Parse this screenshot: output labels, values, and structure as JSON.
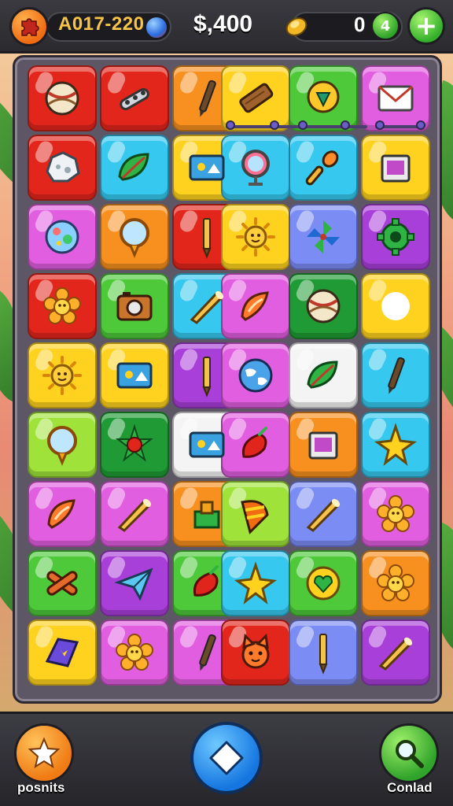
{
  "hud": {
    "level_text": "A017-220",
    "money": "$,400",
    "coins": "0",
    "coin_badge": "4",
    "plus_label": "+"
  },
  "bottom": {
    "left_label": "posnits",
    "right_label": "Conlad"
  },
  "colors": {
    "red": "#e2261c",
    "orange": "#f7901e",
    "yellow": "#ffd21f",
    "green": "#4ec93a",
    "cyan": "#36c8ef",
    "pink": "#e25ee0",
    "purple": "#a93fd9",
    "periwinkle": "#7c8cf5",
    "lime": "#9fe33a",
    "white": "#f4f4f4",
    "darkgreen": "#1f9a34"
  },
  "board": {
    "rows": [
      [
        [
          "red",
          "ball-icon"
        ],
        [
          "red",
          "wrench-icon"
        ],
        [
          "orange",
          "pen-icon"
        ],
        [
          "yellow",
          "plank-icon"
        ],
        [
          "green",
          "badge-icon"
        ],
        [
          "pink",
          "envelope-icon"
        ]
      ],
      [
        [
          "red",
          "rock-icon"
        ],
        [
          "cyan",
          "leaf-icon"
        ],
        [
          "yellow",
          "card-icon"
        ],
        [
          "cyan",
          "mirror-icon"
        ],
        [
          "cyan",
          "microphone-icon"
        ],
        [
          "yellow",
          "box-icon"
        ]
      ],
      [
        [
          "pink",
          "globe-orb-icon"
        ],
        [
          "orange",
          "magnifier-icon"
        ],
        [
          "red",
          "pencil-icon"
        ],
        [
          "yellow",
          "sun-icon"
        ],
        [
          "periwinkle",
          "pinwheel-icon"
        ],
        [
          "purple",
          "cog-icon"
        ]
      ],
      [
        [
          "red",
          "flower-icon"
        ],
        [
          "green",
          "camera-icon"
        ],
        [
          "cyan",
          "horn-icon"
        ],
        [
          "pink",
          "drop-icon"
        ],
        [
          "darkgreen",
          "ball-icon"
        ],
        [
          "yellow",
          "bird-icon"
        ]
      ],
      [
        [
          "yellow",
          "sun-icon"
        ],
        [
          "yellow",
          "card-icon"
        ],
        [
          "purple",
          "pencil-icon"
        ],
        [
          "pink",
          "globe-icon"
        ],
        [
          "white",
          "leaf-icon"
        ],
        [
          "cyan",
          "pen-icon"
        ]
      ],
      [
        [
          "lime",
          "magnifier-icon"
        ],
        [
          "darkgreen",
          "star-flower-icon"
        ],
        [
          "white",
          "card-icon"
        ],
        [
          "pink",
          "pepper-icon"
        ],
        [
          "orange",
          "box-icon"
        ],
        [
          "cyan",
          "star-icon"
        ]
      ],
      [
        [
          "pink",
          "drop-icon"
        ],
        [
          "pink",
          "horn-icon"
        ],
        [
          "orange",
          "block-icon"
        ],
        [
          "lime",
          "cone-icon"
        ],
        [
          "periwinkle",
          "horn-icon"
        ],
        [
          "pink",
          "flower-icon"
        ]
      ],
      [
        [
          "green",
          "sticks-icon"
        ],
        [
          "purple",
          "plane-icon"
        ],
        [
          "green",
          "pepper-icon"
        ],
        [
          "cyan",
          "star-icon"
        ],
        [
          "green",
          "heart-icon"
        ],
        [
          "orange",
          "flower-icon"
        ]
      ],
      [
        [
          "yellow",
          "gem-icon"
        ],
        [
          "pink",
          "flower-icon"
        ],
        [
          "pink",
          "pen-icon"
        ],
        [
          "red",
          "cat-icon"
        ],
        [
          "periwinkle",
          "pencil-icon"
        ],
        [
          "purple",
          "horn-icon"
        ]
      ]
    ]
  }
}
